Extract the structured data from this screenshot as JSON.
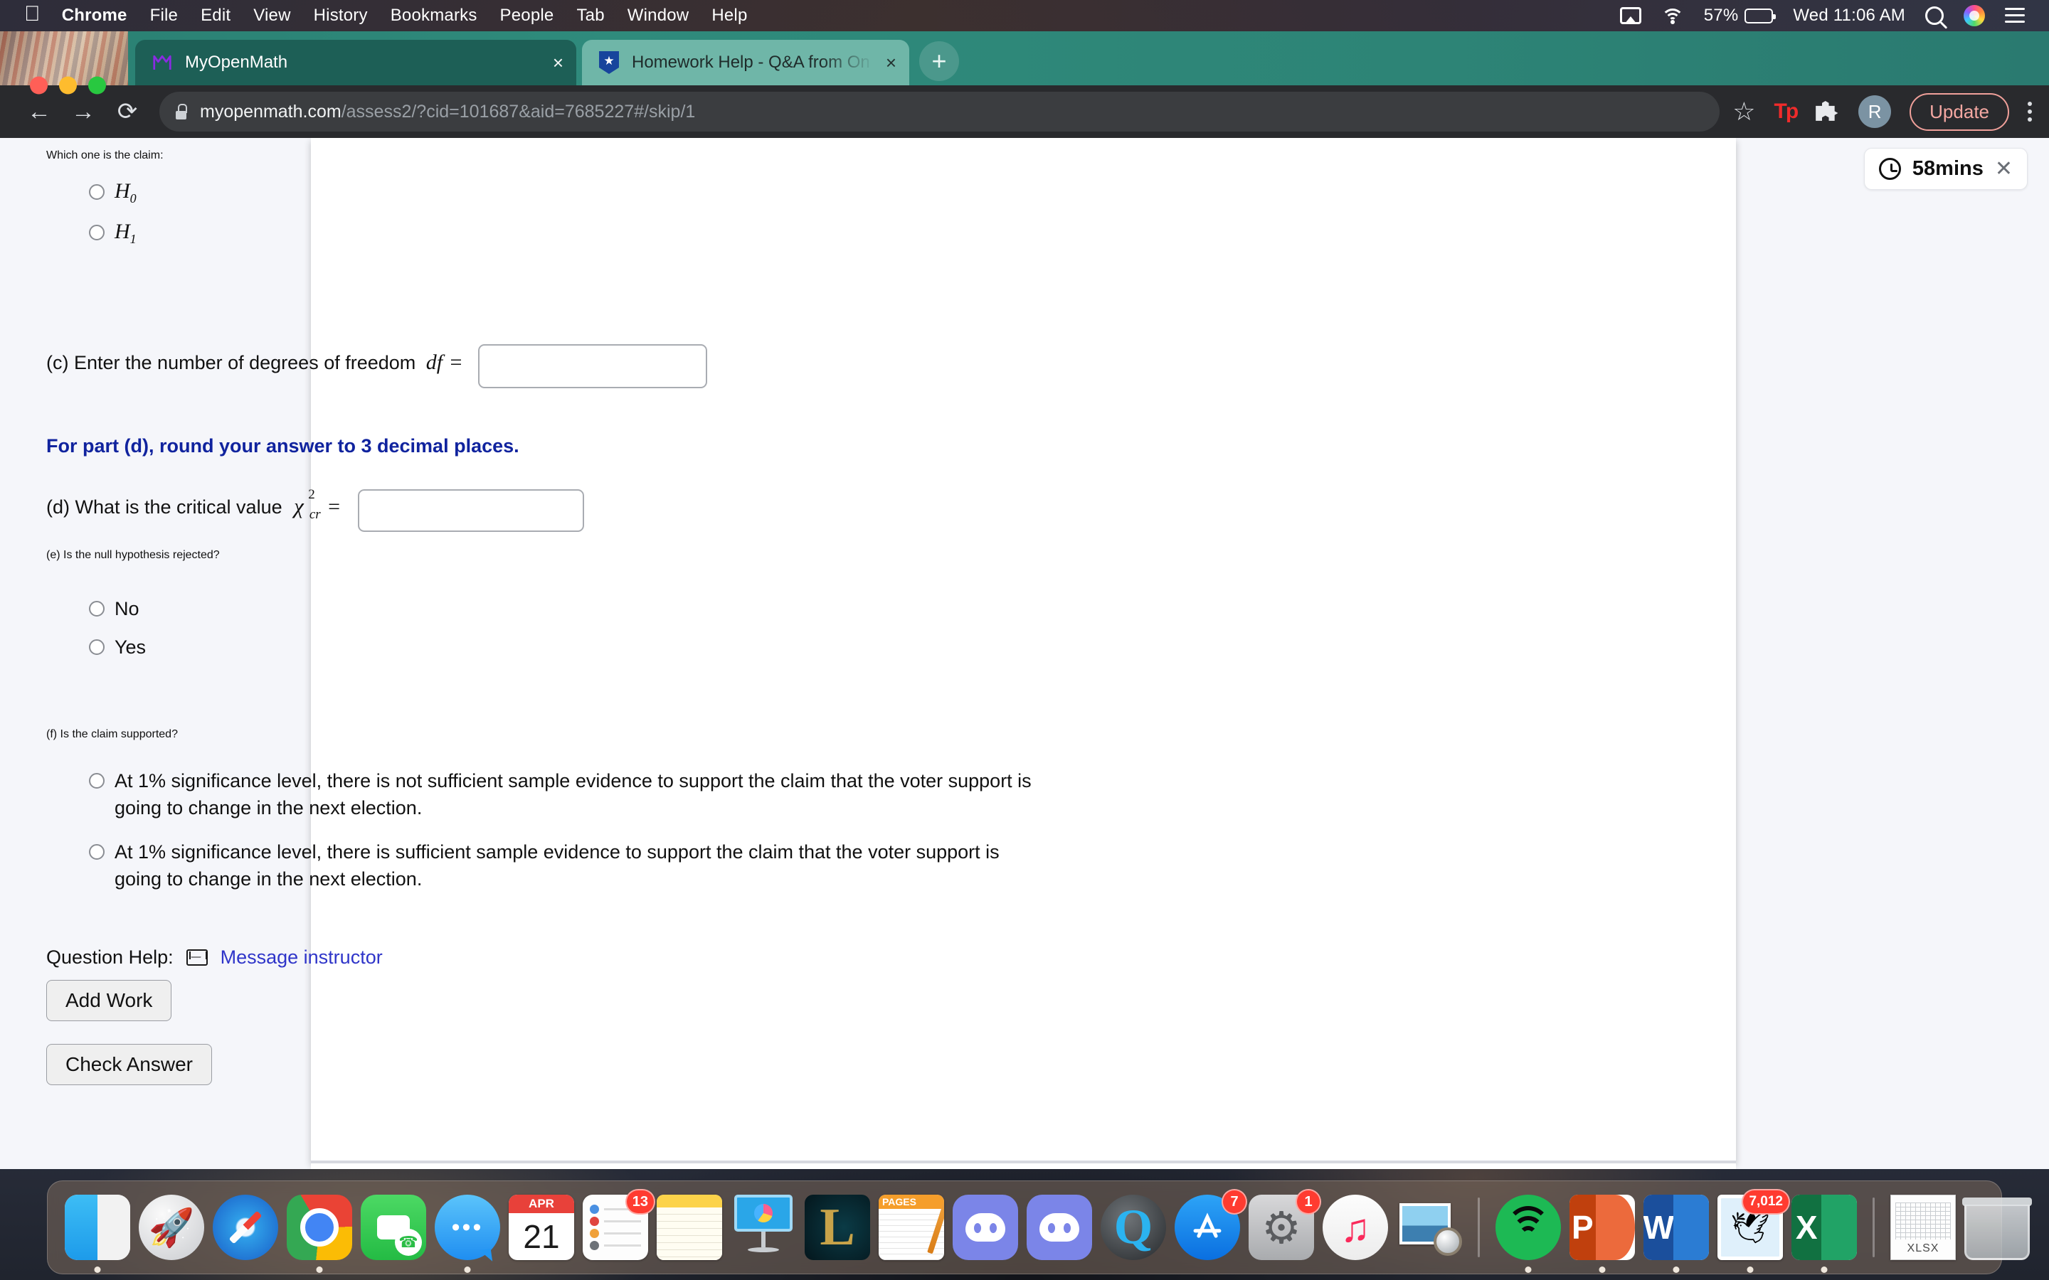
{
  "menubar": {
    "apple_glyph": "",
    "items": [
      "Chrome",
      "File",
      "Edit",
      "View",
      "History",
      "Bookmarks",
      "People",
      "Tab",
      "Window",
      "Help"
    ],
    "battery_percent": "57%",
    "clock": "Wed 11:06 AM",
    "icons": [
      "airplay-icon",
      "wifi-icon",
      "battery-icon",
      "spotlight-search-icon",
      "siri-icon",
      "control-center-icon"
    ]
  },
  "browser": {
    "tabs": [
      {
        "title": "MyOpenMath",
        "favicon": "myopenmath-favicon",
        "active": true,
        "close": "×"
      },
      {
        "title": "Homework Help - Q&A from On",
        "favicon": "coursehero-favicon",
        "active": false,
        "close": "×"
      }
    ],
    "new_tab_label": "+",
    "nav": {
      "back": "←",
      "forward": "→",
      "reload": "⟳"
    },
    "omnibox": {
      "lock_icon": "lock-icon",
      "host": "myopenmath.com",
      "path": "/assess2/?cid=101687&aid=7685227#/skip/1"
    },
    "toolbar_right": {
      "bookmark_star": "☆",
      "extension_tp": "Tp",
      "extensions_puzzle": "puzzle-icon",
      "profile_initial": "R",
      "update_label": "Update",
      "menu": "kebab-menu-icon"
    }
  },
  "timer": {
    "clock_icon": "clock-icon",
    "label": "58mins",
    "close": "✕"
  },
  "question": {
    "claim_prompt": "Which one is the claim:",
    "claim_options": [
      {
        "base": "H",
        "sub": "0"
      },
      {
        "base": "H",
        "sub": "1"
      }
    ],
    "part_c": {
      "text": "(c) Enter the number of degrees of freedom",
      "symbol": "df",
      "equals": "=",
      "input_value": "",
      "input_placeholder": ""
    },
    "rounding_note": "For part (d), round your answer to 3 decimal places.",
    "part_d": {
      "text": "(d) What is the critical value",
      "symbol_base": "χ",
      "symbol_sup": "2",
      "symbol_sub": "cr",
      "equals": "=",
      "input_value": "",
      "input_placeholder": ""
    },
    "part_e": {
      "prompt": "(e) Is the null hypothesis rejected?",
      "options": [
        "No",
        "Yes"
      ]
    },
    "part_f": {
      "prompt": "(f) Is the claim supported?",
      "options": [
        "At 1% significance level, there is not sufficient sample evidence to support the claim that the voter support is going to change in the next election.",
        "At 1% significance level, there is sufficient sample evidence to support the claim that the voter support is going to change in the next election."
      ]
    },
    "help": {
      "label": "Question Help:",
      "mail_icon": "mail-icon",
      "link": "Message instructor"
    },
    "add_work_label": "Add Work",
    "check_answer_label": "Check Answer"
  },
  "dock": {
    "items": [
      {
        "name": "finder",
        "label": "Finder",
        "running": true
      },
      {
        "name": "launchpad",
        "label": "Launchpad",
        "glyph": "🚀",
        "running": false
      },
      {
        "name": "safari",
        "label": "Safari",
        "running": false
      },
      {
        "name": "chrome",
        "label": "Google Chrome",
        "running": true
      },
      {
        "name": "facetime",
        "label": "FaceTime",
        "glyph": "☎",
        "running": false
      },
      {
        "name": "messages",
        "label": "Messages",
        "glyph": "•••",
        "running": true
      },
      {
        "name": "calendar",
        "label": "Calendar",
        "month": "APR",
        "day": "21",
        "running": false
      },
      {
        "name": "reminders",
        "label": "Reminders",
        "badge": "13",
        "running": false
      },
      {
        "name": "notes",
        "label": "Notes",
        "running": false
      },
      {
        "name": "keynote",
        "label": "Keynote",
        "running": false
      },
      {
        "name": "league-of-legends",
        "label": "League of Legends",
        "glyph": "L",
        "running": false
      },
      {
        "name": "pages",
        "label": "Pages",
        "doc_label": "PAGES",
        "running": false
      },
      {
        "name": "discord",
        "label": "Discord",
        "running": false
      },
      {
        "name": "discord-ptb",
        "label": "Discord PTB",
        "running": false
      },
      {
        "name": "quicktime",
        "label": "QuickTime Player",
        "glyph": "Q",
        "running": false
      },
      {
        "name": "app-store",
        "label": "App Store",
        "glyph": "🅐",
        "badge": "7",
        "running": false
      },
      {
        "name": "system-preferences",
        "label": "System Preferences",
        "glyph": "⚙",
        "badge": "1",
        "running": false
      },
      {
        "name": "music",
        "label": "Music",
        "glyph": "♫",
        "running": false
      },
      {
        "name": "preview",
        "label": "Preview",
        "running": false
      },
      {
        "name": "separator-1",
        "label": "",
        "separator": true
      },
      {
        "name": "spotify",
        "label": "Spotify",
        "running": true
      },
      {
        "name": "powerpoint",
        "label": "Microsoft PowerPoint",
        "glyph": "P",
        "running": true
      },
      {
        "name": "word",
        "label": "Microsoft Word",
        "glyph": "W",
        "running": true
      },
      {
        "name": "mail",
        "label": "Mail",
        "glyph": "🕊",
        "badge": "7,012",
        "running": true
      },
      {
        "name": "excel",
        "label": "Microsoft Excel",
        "glyph": "X",
        "running": true
      },
      {
        "name": "separator-2",
        "label": "",
        "separator": true
      },
      {
        "name": "xlsx-file",
        "label": "XLSX",
        "running": false
      },
      {
        "name": "trash",
        "label": "Trash",
        "running": false
      }
    ]
  },
  "colors": {
    "tab_active": "#1d5f56",
    "tab_inactive": "#6fb6a8",
    "chrome_toolbar": "#292a2d",
    "page_bg": "#f5f6fa",
    "note_blue": "#10239e",
    "link_blue": "#2f35c9",
    "update_pill": "#f5a8a2",
    "badge_red": "#ff3b30"
  }
}
